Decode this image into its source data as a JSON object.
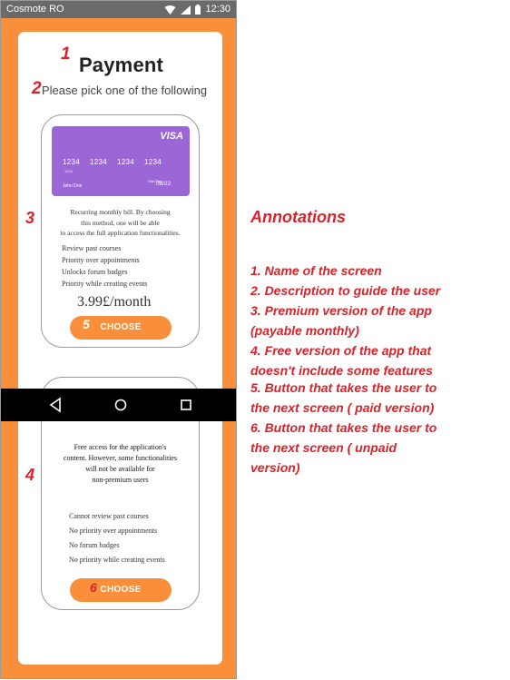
{
  "status_bar": {
    "carrier": "Cosmote RO",
    "time": "12:30"
  },
  "screen": {
    "title": "Payment",
    "subtitle": "Please pick one of the following"
  },
  "premium_plan": {
    "card": {
      "brand": "VISA",
      "number_groups": [
        "1234",
        "1234",
        "1234",
        "1234"
      ],
      "small_text": "1234",
      "holder": "John Doe",
      "valid_label": "Valid Thru",
      "expiry": "08/22"
    },
    "description": [
      "Recurring monthly bill. By choosing",
      "this method, one will be able",
      "to access the full application functionalities."
    ],
    "features": [
      "Review past courses",
      "Priority over appointments",
      "Unlocks forum badges",
      "Priority while creating events"
    ],
    "price": "3.99£/month",
    "button": "CHOOSE"
  },
  "free_plan": {
    "description": [
      "Free access for the application's",
      "content. However, some functionalities",
      "will not be available for",
      "non-premium users"
    ],
    "features": [
      "Cannot review past courses",
      "No priority over appointments",
      "No forum badges",
      "No priority while creating events"
    ],
    "button": "CHOOSE"
  },
  "markers": {
    "m1": "1",
    "m2": "2",
    "m3": "3",
    "m4": "4",
    "m5": "5",
    "m6": "6"
  },
  "annotations": {
    "heading": "Annotations",
    "lines": [
      "1. Name of the screen",
      "2. Description to guide the user",
      "3. Premium version of the app",
      "(payable monthly)",
      "4. Free version of the app that",
      "doesn't include some features",
      "5. Button that takes the user to",
      "the next screen ( paid version)",
      "6. Button that takes the user to",
      "the next screen ( unpaid",
      "version)"
    ]
  },
  "colors": {
    "accent": "#f98f3a",
    "card": "#9d66d6",
    "annotation": "#d9232a"
  },
  "icons": {
    "nav": [
      "back-icon",
      "home-icon",
      "recents-icon"
    ],
    "status": [
      "wifi-icon",
      "signal-icon",
      "battery-icon"
    ]
  }
}
